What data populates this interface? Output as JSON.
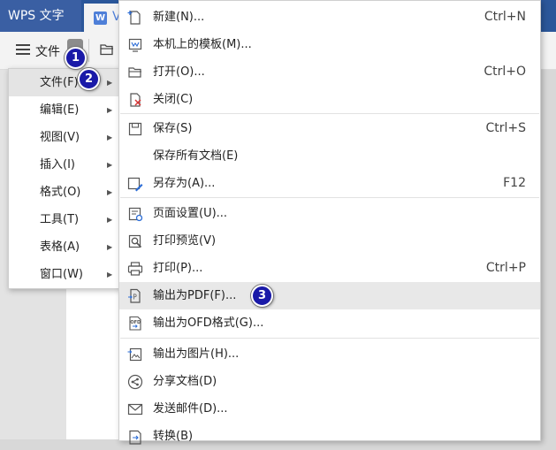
{
  "app": {
    "title": "WPS 文字",
    "doc_tab_letter": "W",
    "doc_tab_text": "V"
  },
  "toolbar": {
    "file_label": "文件"
  },
  "left_menu": [
    {
      "label": "文件(F)",
      "highlighted": true
    },
    {
      "label": "编辑(E)"
    },
    {
      "label": "视图(V)"
    },
    {
      "label": "插入(I)"
    },
    {
      "label": "格式(O)"
    },
    {
      "label": "工具(T)"
    },
    {
      "label": "表格(A)"
    },
    {
      "label": "窗口(W)"
    }
  ],
  "main_menu": [
    {
      "label": "新建(N)...",
      "shortcut": "Ctrl+N",
      "icon": "new-doc-icon"
    },
    {
      "label": "本机上的模板(M)...",
      "shortcut": "",
      "icon": "template-icon"
    },
    {
      "label": "打开(O)...",
      "shortcut": "Ctrl+O",
      "icon": "folder-open-icon"
    },
    {
      "label": "关闭(C)",
      "shortcut": "",
      "icon": "close-doc-icon"
    },
    {
      "label": "保存(S)",
      "shortcut": "Ctrl+S",
      "icon": "save-icon"
    },
    {
      "label": "保存所有文档(E)",
      "shortcut": "",
      "icon": ""
    },
    {
      "label": "另存为(A)...",
      "shortcut": "F12",
      "icon": "save-as-icon"
    },
    {
      "label": "页面设置(U)...",
      "shortcut": "",
      "icon": "page-setup-icon"
    },
    {
      "label": "打印预览(V)",
      "shortcut": "",
      "icon": "print-preview-icon"
    },
    {
      "label": "打印(P)...",
      "shortcut": "Ctrl+P",
      "icon": "printer-icon"
    },
    {
      "label": "输出为PDF(F)...",
      "shortcut": "",
      "icon": "pdf-export-icon",
      "highlighted": true
    },
    {
      "label": "输出为OFD格式(G)...",
      "shortcut": "",
      "icon": "ofd-export-icon"
    },
    {
      "label": "输出为图片(H)...",
      "shortcut": "",
      "icon": "image-export-icon"
    },
    {
      "label": "分享文档(D)",
      "shortcut": "",
      "icon": "share-icon"
    },
    {
      "label": "发送邮件(D)...",
      "shortcut": "",
      "icon": "mail-icon"
    },
    {
      "label": "转换(B)",
      "shortcut": "",
      "icon": "convert-icon"
    }
  ],
  "badges": [
    "1",
    "2",
    "3"
  ],
  "colors": {
    "title_bar": "#2b579a",
    "badge": "#1a1aa8",
    "accent_blue": "#4e7fd8"
  }
}
